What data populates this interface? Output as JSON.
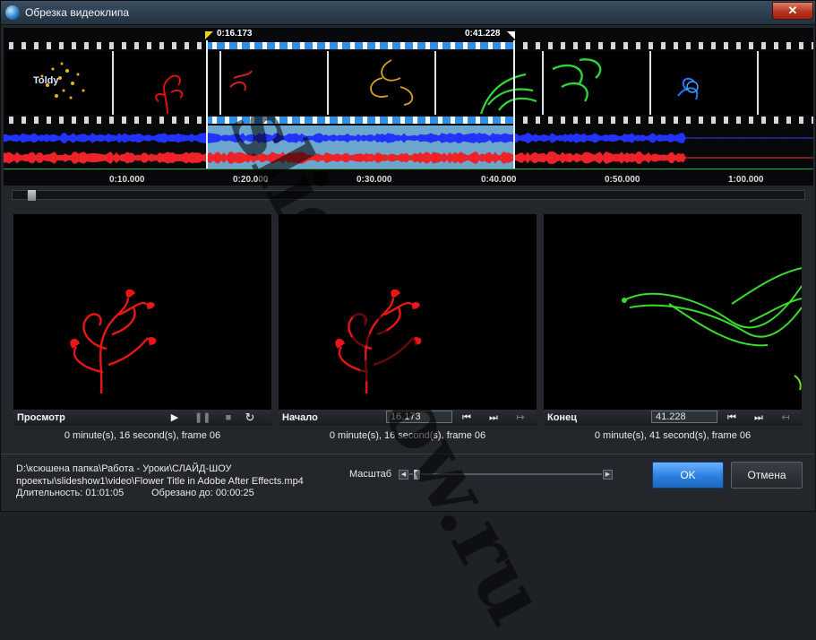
{
  "window": {
    "title": "Обрезка видеоклипа",
    "close_label": "✕"
  },
  "timeline": {
    "selection_start": "0:16.173",
    "selection_end": "0:41.228",
    "ticks": [
      "0:10.000",
      "0:20.000",
      "0:30.000",
      "0:40.000",
      "0:50.000",
      "1:00.000"
    ],
    "frame_thumb_text": "Toldy",
    "colors": {
      "selection": "#2f8ee6",
      "wave_left": "#2432ff",
      "wave_right": "#e8262c",
      "ruler_line": "#2fa84a"
    }
  },
  "panels": {
    "preview": {
      "label": "Просмотр",
      "frame_info": "0 minute(s), 16 second(s), frame 06",
      "icons": [
        "play-icon",
        "pause-icon",
        "stop-icon",
        "loop-icon"
      ]
    },
    "start": {
      "label": "Начало",
      "timecode": "16.173",
      "frame_info": "0 minute(s), 16 second(s), frame 06",
      "icons": [
        "go-first-icon",
        "go-next-icon",
        "set-start-icon"
      ]
    },
    "end": {
      "label": "Конец",
      "timecode": "41.228",
      "frame_info": "0 minute(s), 41 second(s), frame 06",
      "icons": [
        "go-prev-icon",
        "go-last-icon",
        "set-end-icon"
      ]
    }
  },
  "file": {
    "path_line1": "D:\\ксюшена папка\\Работа - Уроки\\СЛАЙД-ШОУ",
    "path_line2": "проекты\\slideshow1\\video\\Flower Title in Adobe After Effects.mp4",
    "duration_label": "Длительность: 01:01:05",
    "trimmed_label": "Обрезано до: 00:00:25"
  },
  "scale": {
    "label": "Масштаб",
    "value": 0.02
  },
  "buttons": {
    "ok": "OK",
    "cancel": "Отмена"
  },
  "watermark": "slideshow.ru"
}
